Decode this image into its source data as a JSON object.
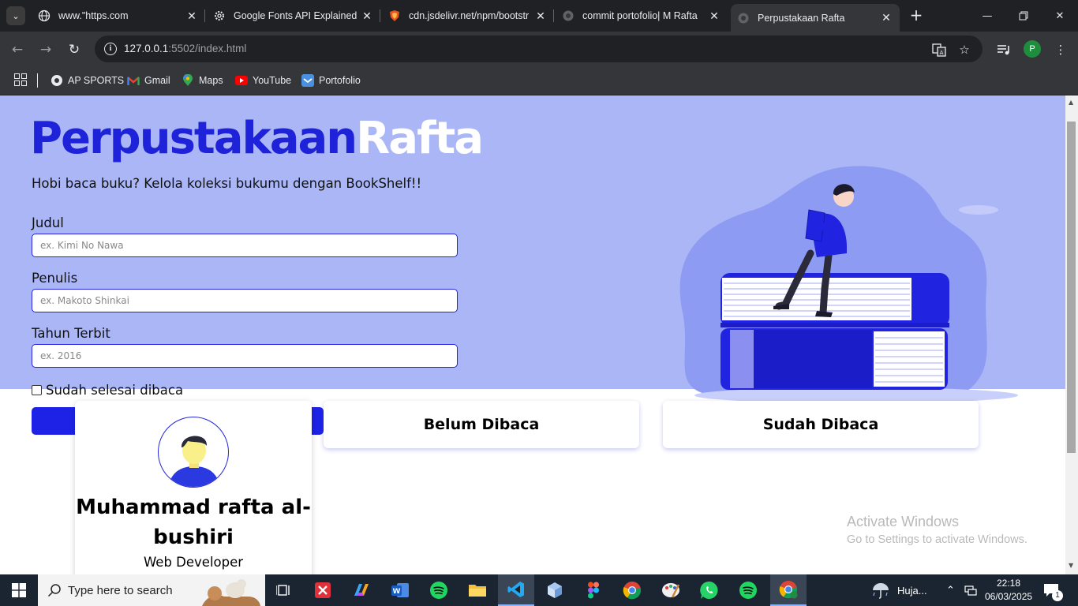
{
  "browser": {
    "tabs": [
      {
        "title": "www.\"https.com"
      },
      {
        "title": "Google Fonts API Explained"
      },
      {
        "title": "cdn.jsdelivr.net/npm/bootstr"
      },
      {
        "title": "commit portofolio| M Rafta"
      },
      {
        "title": "Perpustakaan Rafta",
        "active": true
      }
    ],
    "url_host": "127.0.0.1",
    "url_rest": ":5502/index.html",
    "profile_initial": "P",
    "bookmarks": [
      {
        "label": "AP SPORTS",
        "icon": "globe-icon"
      },
      {
        "label": "Gmail",
        "icon": "gmail-icon"
      },
      {
        "label": "Maps",
        "icon": "maps-icon"
      },
      {
        "label": "YouTube",
        "icon": "youtube-icon"
      },
      {
        "label": "Portofolio",
        "icon": "portofolio-icon"
      }
    ]
  },
  "page": {
    "brand_part1": "Perpustakaan",
    "brand_part2": "Rafta",
    "tagline": "Hobi baca buku? Kelola koleksi bukumu dengan BookShelf!!",
    "form": {
      "title_label": "Judul",
      "title_placeholder": "ex. Kimi No Nawa",
      "author_label": "Penulis",
      "author_placeholder": "ex. Makoto Shinkai",
      "year_label": "Tahun Terbit",
      "year_placeholder": "ex. 2016",
      "complete_label": "Sudah selesai dibaca",
      "complete_checked": false
    },
    "shelves": {
      "unread_label": "Belum Dibaca",
      "read_label": "Sudah Dibaca"
    },
    "profile": {
      "name": "Muhammad rafta al-bushiri",
      "role": "Web Developer"
    },
    "colors": {
      "hero_bg": "#aab6f6",
      "brand_blue": "#1e22d8",
      "button_blue": "#1e22e6"
    }
  },
  "os": {
    "watermark_title": "Activate Windows",
    "watermark_sub": "Go to Settings to activate Windows.",
    "search_placeholder": "Type here to search",
    "weather": "Huja...",
    "time": "22:18",
    "date": "06/03/2025",
    "notification_count": "1"
  }
}
